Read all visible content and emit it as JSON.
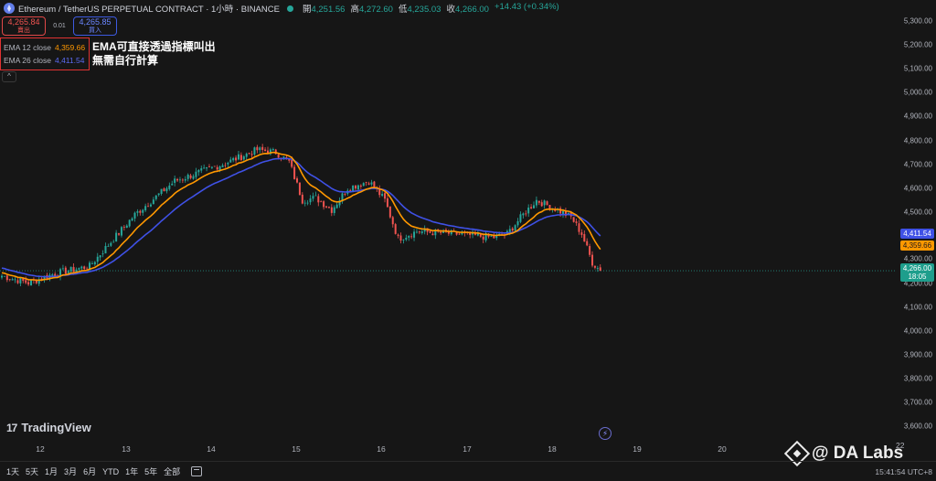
{
  "header": {
    "title": "Ethereum / TetherUS PERPETUAL CONTRACT · 1小時 · BINANCE",
    "ohlc": [
      {
        "label": "開",
        "value": "4,251.56"
      },
      {
        "label": "高",
        "value": "4,272.60"
      },
      {
        "label": "低",
        "value": "4,235.03"
      },
      {
        "label": "收",
        "value": "4,266.00"
      },
      {
        "label": "",
        "value": "+14.43 (+0.34%)"
      }
    ]
  },
  "trade": {
    "sell_price": "4,265.84",
    "sell_label": "賣出",
    "spread": "0.01",
    "buy_price": "4,265.85",
    "buy_label": "買入"
  },
  "indicators": {
    "ema12_name": "EMA 12 close",
    "ema12_value": "4,359.66",
    "ema26_name": "EMA 26 close",
    "ema26_value": "4,411.54",
    "collapse_glyph": "^"
  },
  "annotation": {
    "line1": "EMA可直接透過指標叫出",
    "line2": "無需自行計算"
  },
  "price_axis": {
    "labels": [
      "5,300.00",
      "5,200.00",
      "5,100.00",
      "5,000.00",
      "4,900.00",
      "4,800.00",
      "4,700.00",
      "4,600.00",
      "4,500.00",
      "4,300.00",
      "4,200.00",
      "4,100.00",
      "4,000.00",
      "3,900.00",
      "3,800.00",
      "3,700.00",
      "3,600.00"
    ],
    "ema26_tag": "4,411.54",
    "ema12_tag": "4,359.66",
    "last_price_tag": "4,266.00",
    "countdown_tag": "18:05"
  },
  "time_axis": {
    "labels": [
      "12",
      "13",
      "14",
      "15",
      "16",
      "17",
      "18",
      "19",
      "20"
    ],
    "right_label": "22"
  },
  "branding": {
    "tv_mark": "17",
    "tv_name": "TradingView",
    "flash_glyph": "⚡",
    "watermark": "@ DA Labs"
  },
  "bottom_bar": {
    "ranges": [
      "1天",
      "5天",
      "1月",
      "3月",
      "6月",
      "YTD",
      "1年",
      "5年",
      "全部"
    ],
    "clock": "15:41:54 UTC+8"
  },
  "colors": {
    "up": "#26a69a",
    "down": "#ef5350",
    "ema12": "#ff9800",
    "ema26": "#3f51e6",
    "background": "#161616"
  },
  "chart_data": {
    "type": "candlestick",
    "symbol": "ETHUSDT.P",
    "interval": "1小時",
    "ylim": [
      3580,
      5330
    ],
    "ema12_last": 4359.66,
    "ema26_last": 4411.54,
    "last_close": 4266.0,
    "price_anchors": [
      {
        "t": 0,
        "p": 4245
      },
      {
        "t": 10,
        "p": 4215
      },
      {
        "t": 20,
        "p": 4255
      },
      {
        "t": 33,
        "p": 4285
      },
      {
        "t": 50,
        "p": 4500
      },
      {
        "t": 65,
        "p": 4640
      },
      {
        "t": 83,
        "p": 4710
      },
      {
        "t": 96,
        "p": 4770
      },
      {
        "t": 103,
        "p": 4760
      },
      {
        "t": 108,
        "p": 4720
      },
      {
        "t": 113,
        "p": 4560
      },
      {
        "t": 118,
        "p": 4570
      },
      {
        "t": 124,
        "p": 4520
      },
      {
        "t": 130,
        "p": 4610
      },
      {
        "t": 138,
        "p": 4640
      },
      {
        "t": 144,
        "p": 4560
      },
      {
        "t": 149,
        "p": 4400
      },
      {
        "t": 156,
        "p": 4430
      },
      {
        "t": 170,
        "p": 4420
      },
      {
        "t": 185,
        "p": 4405
      },
      {
        "t": 190,
        "p": 4420
      },
      {
        "t": 196,
        "p": 4500
      },
      {
        "t": 201,
        "p": 4560
      },
      {
        "t": 207,
        "p": 4530
      },
      {
        "t": 214,
        "p": 4490
      },
      {
        "t": 218,
        "p": 4420
      },
      {
        "t": 222,
        "p": 4300
      },
      {
        "t": 225,
        "p": 4266
      }
    ]
  }
}
